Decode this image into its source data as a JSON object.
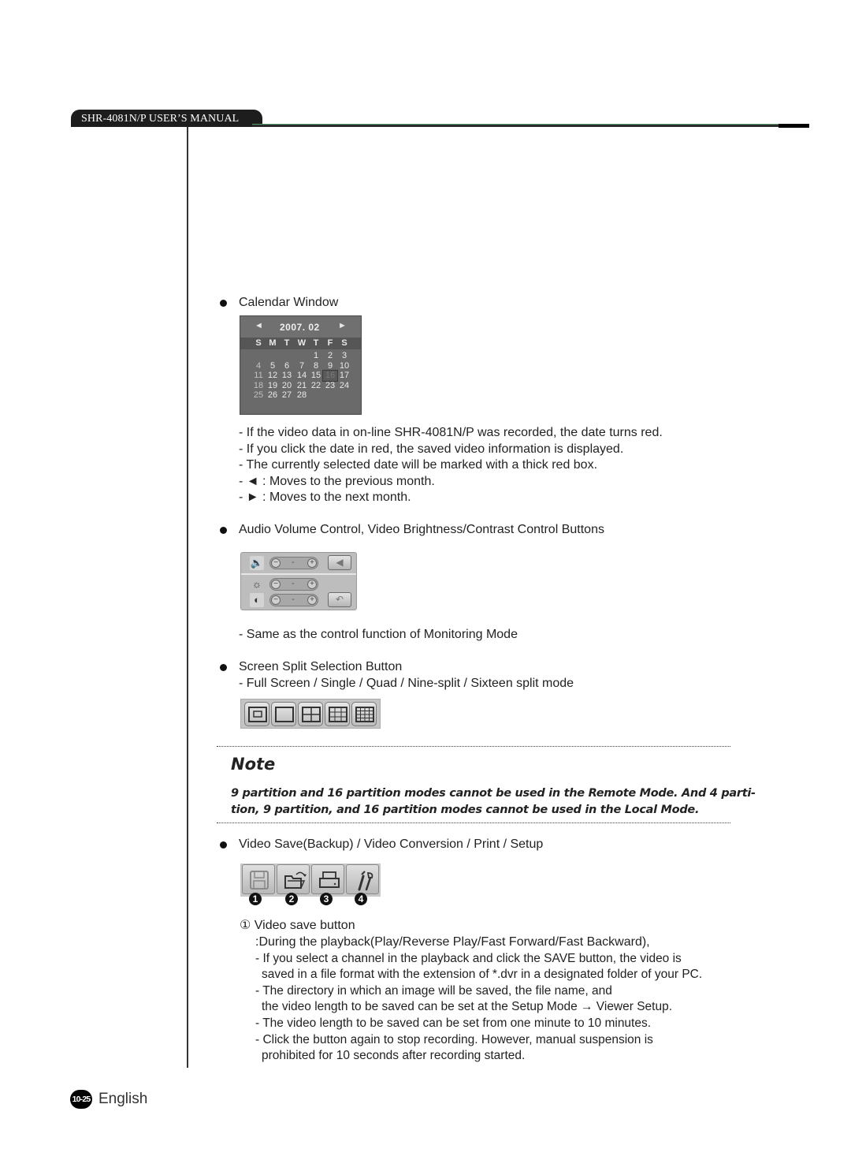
{
  "header": {
    "manual_title": "SHR-4081N/P USER’S MANUAL"
  },
  "calendar_section": {
    "heading": "Calendar Window",
    "widget": {
      "prev_glyph": "◄",
      "next_glyph": "►",
      "title": "2007. 02",
      "weekdays": [
        "S",
        "M",
        "T",
        "W",
        "T",
        "F",
        "S"
      ],
      "first_weekday_index": 4,
      "days_in_month": 28,
      "selected_day": 16
    },
    "notes": [
      "- If the video data in on-line SHR-4081N/P was recorded, the date turns red.",
      "- If you click the date in red, the saved video information is displayed.",
      "- The currently selected date will be marked with a thick red box.",
      "- ◄ : Moves to the previous month.",
      "- ► : Moves to the next month."
    ]
  },
  "controls_section": {
    "heading": "Audio Volume Control, Video Brightness/Contrast Control Buttons",
    "rows": [
      {
        "name": "volume",
        "icon": "speaker-icon",
        "icon_glyph": "🔈",
        "minus": "−",
        "value": "-",
        "plus": "+"
      },
      {
        "name": "brightness",
        "icon": "sun-icon",
        "icon_glyph": "☼",
        "minus": "−",
        "value": "-",
        "plus": "+"
      },
      {
        "name": "contrast",
        "icon": "contrast-icon",
        "icon_glyph": "◐",
        "minus": "−",
        "value": "-",
        "plus": "+"
      }
    ],
    "mute_glyph": "◀",
    "reset_glyph": "↶",
    "note": "- Same as the control function of Monitoring Mode"
  },
  "split_section": {
    "heading": "Screen Split Selection Button",
    "subheading": "- Full Screen / Single / Quad / Nine-split / Sixteen split mode",
    "buttons": [
      "Full Screen",
      "Single",
      "Quad",
      "Nine-split",
      "Sixteen split"
    ]
  },
  "note_box": {
    "title": "Note",
    "line1": "9 partition and 16 partition modes cannot be used in the Remote Mode. And 4 parti-",
    "line2": "tion, 9 partition, and 16 partition modes cannot be used in the Local Mode."
  },
  "tools_section": {
    "heading": "Video Save(Backup) / Video Conversion / Print / Setup",
    "buttons": [
      {
        "name": "save",
        "number": "1"
      },
      {
        "name": "convert",
        "number": "2"
      },
      {
        "name": "print",
        "number": "3"
      },
      {
        "name": "setup",
        "number": "4"
      }
    ],
    "save_heading": "① Video save button",
    "save_intro": ":During the playback(Play/Reverse Play/Fast Forward/Fast Backward),",
    "save_lines": [
      "- If you select a channel in the playback and click the SAVE button, the video is",
      "saved in a file format with the extension of *.dvr in a designated folder of your PC.",
      "- The directory in which an image will be saved, the file name, and",
      "the video length to be saved can be set at the Setup Mode → Viewer Setup.",
      "- The video length to be saved can be set from one minute to 10 minutes.",
      "- Click the button again to stop recording. However, manual suspension is",
      "prohibited for 10 seconds after recording started."
    ]
  },
  "footer": {
    "page_number": "10-25",
    "language": "English"
  }
}
